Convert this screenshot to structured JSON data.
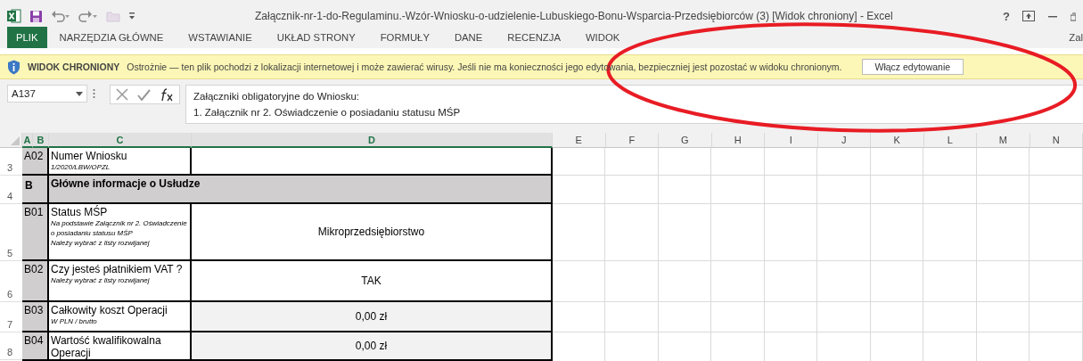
{
  "window": {
    "title": "Załącznik-nr-1-do-Regulaminu.-Wzór-Wniosku-o-udzielenie-Lubuskiego-Bonu-Wsparcia-Przedsiębiorców (3)  [Widok chroniony] - Excel",
    "help": "?"
  },
  "ribbon": {
    "tabs": [
      {
        "label": "PLIK",
        "kind": "file"
      },
      {
        "label": "NARZĘDZIA GŁÓWNE",
        "kind": "tab"
      },
      {
        "label": "WSTAWIANIE",
        "kind": "tab"
      },
      {
        "label": "UKŁAD STRONY",
        "kind": "tab"
      },
      {
        "label": "FORMUŁY",
        "kind": "tab"
      },
      {
        "label": "DANE",
        "kind": "tab"
      },
      {
        "label": "RECENZJA",
        "kind": "tab"
      },
      {
        "label": "WIDOK",
        "kind": "tab"
      }
    ],
    "account": "Zal"
  },
  "message_bar": {
    "label": "WIDOK CHRONIONY",
    "message": "Ostrożnie — ten plik pochodzi z lokalizacji internetowej i może zawierać wirusy. Jeśli nie ma konieczności jego edytowania, bezpieczniej jest pozostać w widoku chronionym.",
    "button": "Włącz edytowanie"
  },
  "formula_bar": {
    "name_box": "A137",
    "formula": [
      "Załączniki obligatoryjne do Wniosku:",
      "1. Załącznik nr 2. Oświadczenie o posiadaniu statusu MŚP"
    ]
  },
  "sheet": {
    "columns": [
      {
        "label": "A",
        "selected": true
      },
      {
        "label": "B",
        "selected": true
      },
      {
        "label": "C",
        "selected": true
      },
      {
        "label": "D",
        "selected": true
      },
      {
        "label": "E",
        "selected": false
      },
      {
        "label": "F",
        "selected": false
      },
      {
        "label": "G",
        "selected": false
      },
      {
        "label": "H",
        "selected": false
      },
      {
        "label": "I",
        "selected": false
      },
      {
        "label": "J",
        "selected": false
      },
      {
        "label": "K",
        "selected": false
      },
      {
        "label": "L",
        "selected": false
      },
      {
        "label": "M",
        "selected": false
      },
      {
        "label": "N",
        "selected": false
      }
    ],
    "rows": [
      {
        "number": "3",
        "kind": "field",
        "code": "A02",
        "title": "Numer Wniosku",
        "notes": [
          "1/2020/LBW/OPZL"
        ],
        "value": "",
        "shaded": false
      },
      {
        "number": "4",
        "kind": "section",
        "code": "B",
        "title": "Główne informacje o Usłudze"
      },
      {
        "number": "5",
        "kind": "field",
        "code": "B01",
        "title": "Status MŚP",
        "notes": [
          "Na podstawie Załącznik nr 2. Oświadczenie o posiadaniu statusu MŚP",
          "Należy wybrać z listy rozwijanej"
        ],
        "value": "Mikroprzedsiębiorstwo",
        "shaded": false
      },
      {
        "number": "6",
        "kind": "field",
        "code": "B02",
        "title": "Czy jesteś płatnikiem VAT ?",
        "notes": [
          "Należy wybrać z listy rozwijanej"
        ],
        "value": "TAK",
        "shaded": false
      },
      {
        "number": "7",
        "kind": "field",
        "code": "B03",
        "title": "Całkowity koszt Operacji",
        "notes": [
          "W PLN / brutto"
        ],
        "value": "0,00 zł",
        "shaded": true
      },
      {
        "number": "8",
        "kind": "field",
        "code": "B04",
        "title": "Wartość kwalifikowalna Operacji",
        "notes": [],
        "value": "0,00 zł",
        "shaded": true
      }
    ]
  }
}
